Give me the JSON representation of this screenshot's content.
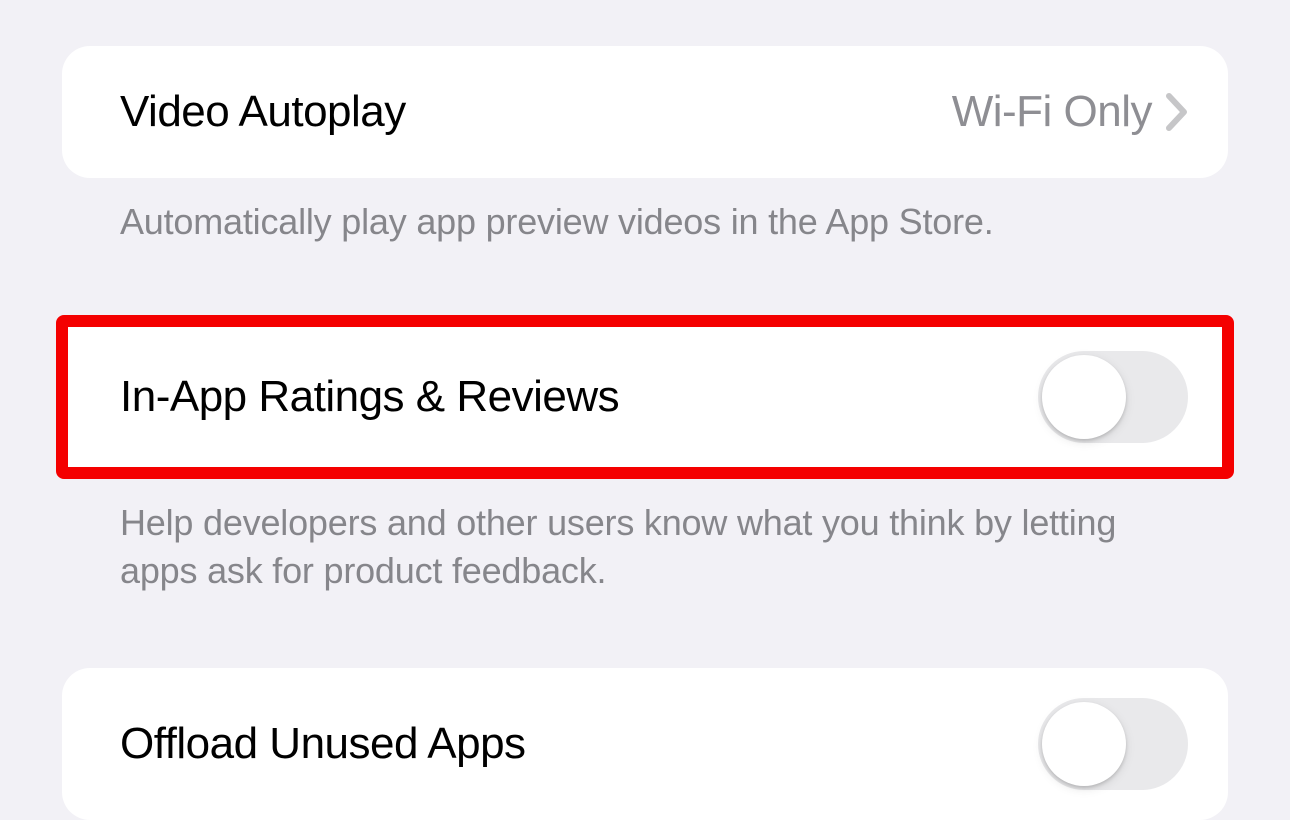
{
  "rows": {
    "videoAutoplay": {
      "label": "Video Autoplay",
      "value": "Wi-Fi Only",
      "footer": "Automatically play app preview videos in the App Store."
    },
    "inAppRatings": {
      "label": "In-App Ratings & Reviews",
      "footer": "Help developers and other users know what you think by letting apps ask for product feedback.",
      "on": false
    },
    "offloadUnused": {
      "label": "Offload Unused Apps",
      "on": false
    }
  }
}
